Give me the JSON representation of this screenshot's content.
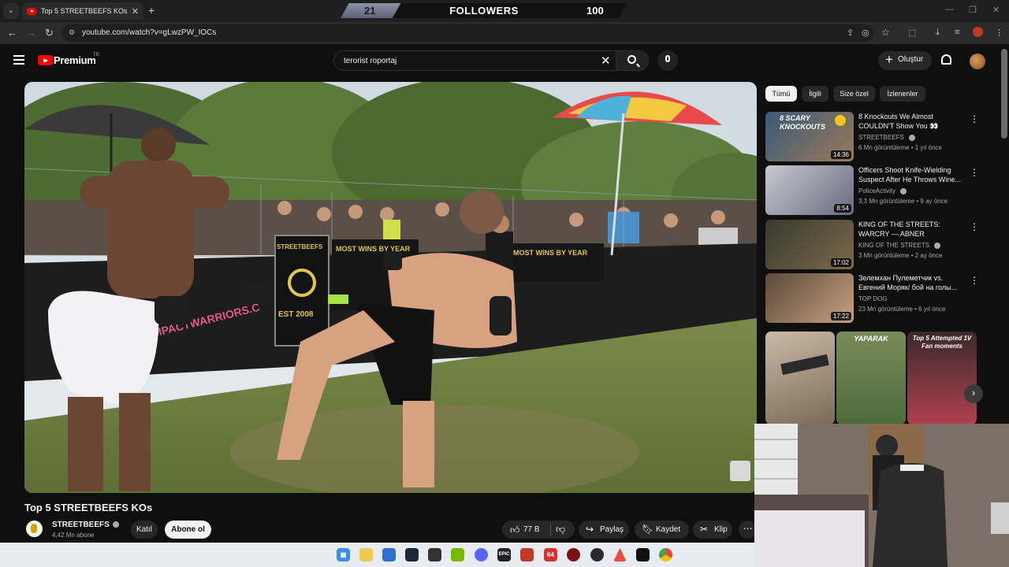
{
  "browser": {
    "tab_title": "Top 5 STREETBEEFS KOs - YouTube",
    "url": "youtube.com/watch?v=gLwzPW_IOCs"
  },
  "followers_overlay": {
    "current": "21",
    "label": "FOLLOWERS",
    "goal": "100",
    "progress": 0.21
  },
  "youtube": {
    "logo_text": "Premium",
    "country": "TR",
    "search_value": "terorist roportaj",
    "create_label": "Oluştur"
  },
  "video": {
    "title": "Top 5 STREETBEEFS KOs",
    "channel": "STREETBEEFS",
    "subscribers": "4,42 Mn abone",
    "join_label": "Katıl",
    "subscribe_label": "Abone ol",
    "likes": "77 B",
    "share_label": "Paylaş",
    "save_label": "Kaydet",
    "clip_label": "Klip",
    "scene_text": {
      "left_banner": "IMPACTWARRIORS.C",
      "sign_top": "STREETBEEFS",
      "sign_bottom": "EST 2008",
      "wins_banner_1": "MOST WINS BY YEAR",
      "wins_banner_2": "MOST WINS BY YEAR"
    }
  },
  "sidebar": {
    "chips": [
      "Tümü",
      "İlgili",
      "Size özel",
      "İzlenenler"
    ],
    "recommendations": [
      {
        "title": "8 Knockouts We Almost COULDN'T Show You 👀",
        "channel": "STREETBEEFS",
        "meta": "6 Mn görüntüleme • 1 yıl önce",
        "duration": "14:36",
        "thumb_text": "8 SCARY KNOCKOUTS",
        "verified": true
      },
      {
        "title": "Officers Shoot Knife-Wielding Suspect After He Throws Wine...",
        "channel": "PoliceActivity",
        "meta": "3,3 Mn görüntüleme • 9 ay önce",
        "duration": "8:54",
        "verified": true
      },
      {
        "title": "KING OF THE STREETS: WARCRY — ABNER LLOVERAS...",
        "channel": "KING OF THE STREETS",
        "meta": "3 Mn görüntüleme • 2 ay önce",
        "duration": "17:02",
        "verified": true
      },
      {
        "title": "Зелемхан Пулеметчик vs. Евгений Моряк/ бой на голы...",
        "channel": "TOP DOG",
        "meta": "23 Mn görüntüleme • 6 yıl önce",
        "duration": "17:22",
        "verified": false
      }
    ],
    "shorts": [
      {
        "label": ""
      },
      {
        "label": "YAPARAK"
      },
      {
        "label": "Top 5 Attempted 1V Fan moments"
      }
    ]
  },
  "icons": {
    "taskbar": [
      "windows-start",
      "file-explorer",
      "store",
      "steam",
      "unity",
      "nvidia",
      "discord",
      "epic-games",
      "app-red",
      "app-64",
      "app-dark",
      "app-record",
      "app-triangle",
      "app-capcut",
      "chrome"
    ],
    "taskbar_labels": {
      "epic": "EPIC",
      "num": "64"
    }
  },
  "colors": {
    "yt_red": "#ff0000",
    "bg": "#0f0f0f",
    "chip": "#272727"
  }
}
